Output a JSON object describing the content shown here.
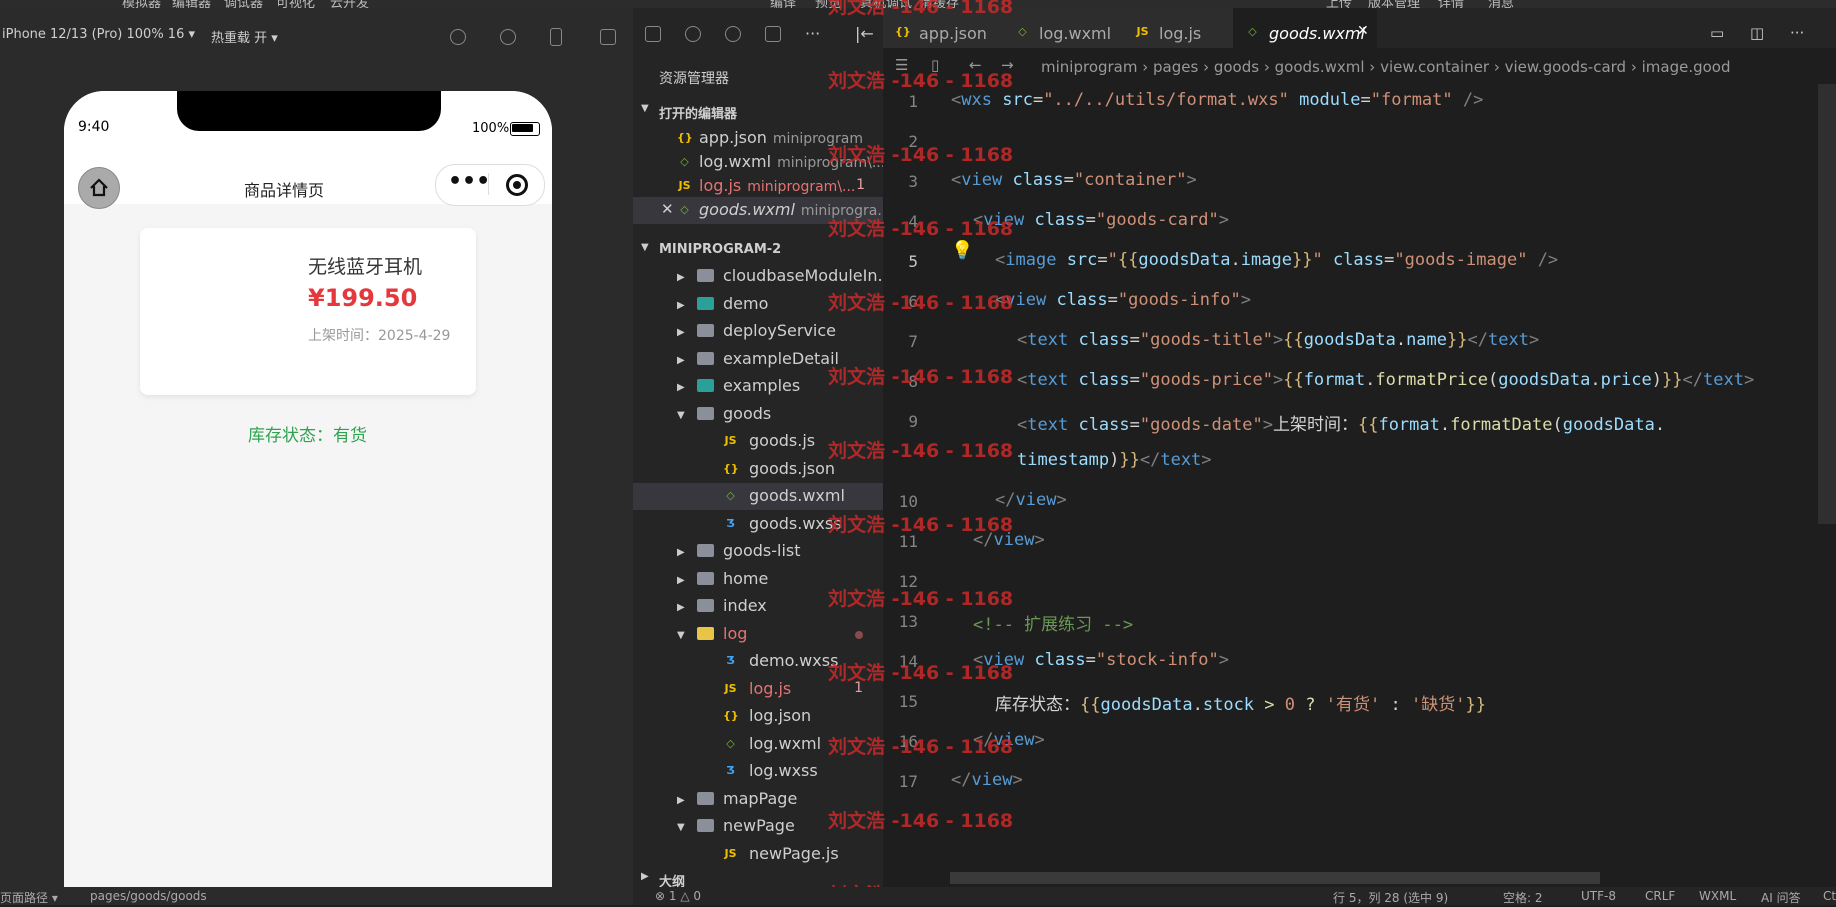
{
  "topbar": {
    "items": [
      "模拟器",
      "编辑器",
      "调试器",
      "可视化",
      "云开发"
    ],
    "right_items": [
      "编译",
      "预览",
      "真机调试",
      "清缓存",
      "上传",
      "版本管理",
      "详情",
      "消息"
    ]
  },
  "simulator": {
    "device": "iPhone 12/13 (Pro) 100% 16 ▾",
    "hot_reload": "热重载 开 ▾",
    "time": "9:40",
    "battery": "100%",
    "nav_title": "商品详情页",
    "capsule_dots": "•••",
    "goods": {
      "title": "无线蓝牙耳机",
      "price": "¥199.50",
      "date": "上架时间：2025-4-29"
    },
    "stock": "库存状态：有货",
    "status_path": "页面路径 ▾",
    "status_page": "pages/goods/goods"
  },
  "explorer": {
    "title": "资源管理器",
    "open_editors_label": "打开的编辑器",
    "open_editors": [
      {
        "name": "app.json",
        "sub": "miniprogram",
        "icon": "json"
      },
      {
        "name": "log.wxml",
        "sub": "miniprogram\\...",
        "icon": "wxml"
      },
      {
        "name": "log.js",
        "sub": "miniprogram\\...",
        "icon": "js",
        "badge": "1",
        "error": true
      },
      {
        "name": "goods.wxml",
        "sub": "miniprogra...",
        "icon": "wxml",
        "active": true
      }
    ],
    "project_label": "MINIPROGRAM-2",
    "tree": [
      {
        "name": "cloudbaseModuleIn...",
        "type": "folder",
        "depth": 1
      },
      {
        "name": "demo",
        "type": "folder-teal",
        "depth": 1
      },
      {
        "name": "deployService",
        "type": "folder",
        "depth": 1
      },
      {
        "name": "exampleDetail",
        "type": "folder",
        "depth": 1
      },
      {
        "name": "examples",
        "type": "folder-teal",
        "depth": 1
      },
      {
        "name": "goods",
        "type": "folder-open",
        "depth": 1
      },
      {
        "name": "goods.js",
        "type": "js",
        "depth": 2
      },
      {
        "name": "goods.json",
        "type": "json",
        "depth": 2
      },
      {
        "name": "goods.wxml",
        "type": "wxml",
        "depth": 2,
        "selected": true
      },
      {
        "name": "goods.wxss",
        "type": "wxss",
        "depth": 2
      },
      {
        "name": "goods-list",
        "type": "folder",
        "depth": 1
      },
      {
        "name": "home",
        "type": "folder",
        "depth": 1
      },
      {
        "name": "index",
        "type": "folder",
        "depth": 1
      },
      {
        "name": "log",
        "type": "folder-open-yellow",
        "depth": 1,
        "error": true
      },
      {
        "name": "demo.wxss",
        "type": "wxss",
        "depth": 2
      },
      {
        "name": "log.js",
        "type": "js",
        "depth": 2,
        "error": true,
        "badge": "1"
      },
      {
        "name": "log.json",
        "type": "json",
        "depth": 2
      },
      {
        "name": "log.wxml",
        "type": "wxml",
        "depth": 2
      },
      {
        "name": "log.wxss",
        "type": "wxss",
        "depth": 2
      },
      {
        "name": "mapPage",
        "type": "folder",
        "depth": 1
      },
      {
        "name": "newPage",
        "type": "folder-open",
        "depth": 1
      },
      {
        "name": "newPage.js",
        "type": "js",
        "depth": 2
      }
    ],
    "outline_label": "大纲",
    "problems": "⊗ 1 △ 0"
  },
  "tabs": [
    {
      "name": "app.json",
      "icon": "json"
    },
    {
      "name": "log.wxml",
      "icon": "wxml"
    },
    {
      "name": "log.js",
      "icon": "js"
    },
    {
      "name": "goods.wxml",
      "icon": "wxml",
      "active": true
    }
  ],
  "breadcrumb": [
    "miniprogram",
    "pages",
    "goods",
    "goods.wxml",
    "view.container",
    "view.goods-card",
    "image.good"
  ],
  "editor": {
    "line_numbers": [
      "1",
      "2",
      "3",
      "4",
      "5",
      "6",
      "7",
      "8",
      "9",
      "",
      "10",
      "11",
      "12",
      "13",
      "14",
      "15",
      "16",
      "17"
    ],
    "watermark": "刘文浩 -146 - 1168"
  },
  "statusbar": {
    "position": "行 5，列 28 (选中 9)",
    "spaces": "空格: 2",
    "encoding": "UTF-8",
    "eol": "CRLF",
    "lang": "WXML",
    "ai": "AI 问答",
    "extra": "Ctrl+I"
  },
  "colors": {
    "price": "#e4393c",
    "stock": "#2ea44f",
    "watermark": "#c92a2a",
    "editor_bg": "#1e1e1e"
  }
}
